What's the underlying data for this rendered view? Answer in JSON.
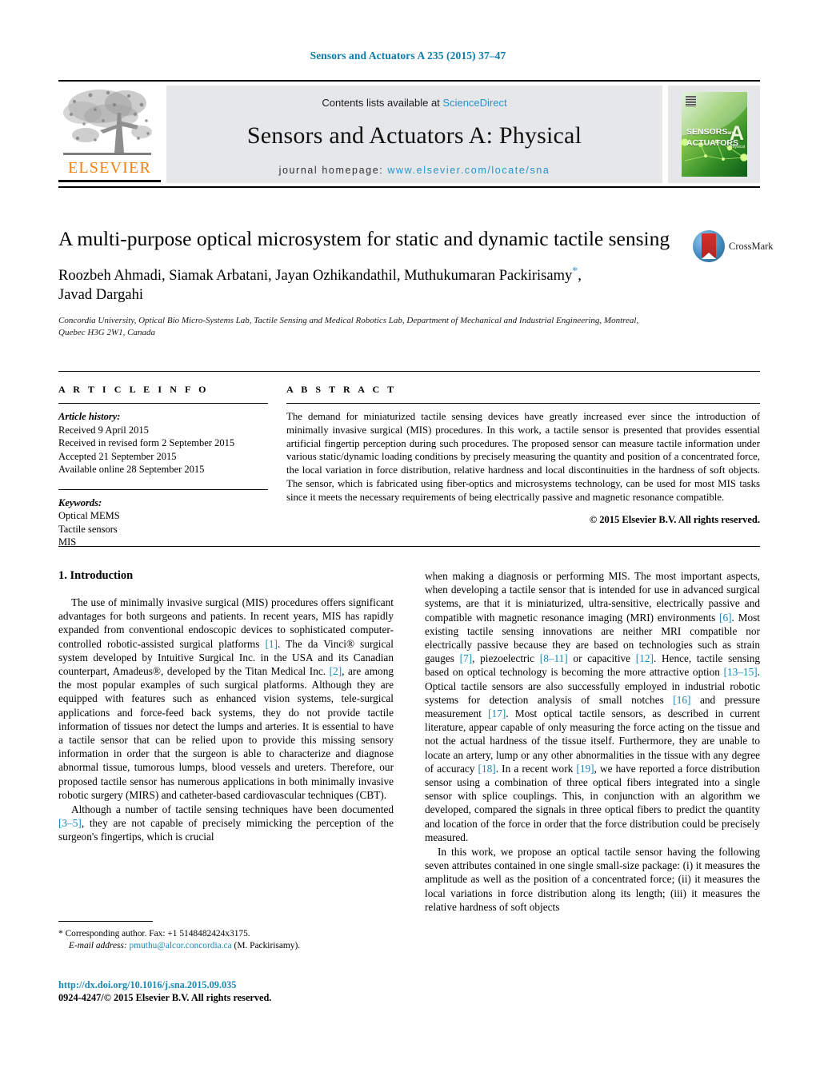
{
  "running_head": "Sensors and Actuators A 235 (2015) 37–47",
  "masthead": {
    "contents_prefix": "Contents lists available at ",
    "contents_link": "ScienceDirect",
    "journal_title": "Sensors and Actuators A: Physical",
    "homepage_prefix": "journal homepage:",
    "homepage_url": "www.elsevier.com/locate/sna",
    "publisher_name": "ELSEVIER",
    "cover": {
      "line1": "SENSORS",
      "line1_small": "and",
      "line2": "ACTUATORS",
      "big_letter": "A",
      "sub_letter": "Physical"
    }
  },
  "article": {
    "title": "A multi-purpose optical microsystem for static and dynamic tactile sensing",
    "authors": "Roozbeh Ahmadi, Siamak Arbatani, Jayan Ozhikandathil, Muthukumaran Packirisamy",
    "authors_line2": "Javad Dargahi",
    "corresponding_marker": "*",
    "affiliation": "Concordia University, Optical Bio Micro-Systems Lab, Tactile Sensing and Medical Robotics Lab, Department of Mechanical and Industrial Engineering, Montreal, Quebec H3G 2W1, Canada",
    "crossmark_label": "CrossMark"
  },
  "article_info": {
    "heading": "A R T I C L E   I N F O",
    "history_label": "Article history:",
    "history": [
      "Received 9 April 2015",
      "Received in revised form 2 September 2015",
      "Accepted 21 September 2015",
      "Available online 28 September 2015"
    ],
    "keywords_label": "Keywords:",
    "keywords": [
      "Optical MEMS",
      "Tactile sensors",
      "MIS"
    ]
  },
  "abstract": {
    "heading": "A B S T R A C T",
    "text": "The demand for miniaturized tactile sensing devices have greatly increased ever since the introduction of minimally invasive surgical (MIS) procedures. In this work, a tactile sensor is presented that provides essential artificial fingertip perception during such procedures. The proposed sensor can measure tactile information under various static/dynamic loading conditions by precisely measuring the quantity and position of a concentrated force, the local variation in force distribution, relative hardness and local discontinuities in the hardness of soft objects. The sensor, which is fabricated using fiber-optics and microsystems technology, can be used for most MIS tasks since it meets the necessary requirements of being electrically passive and magnetic resonance compatible.",
    "copyright": "© 2015 Elsevier B.V. All rights reserved."
  },
  "body": {
    "section_heading": "1. Introduction",
    "left_paragraphs": [
      {
        "parts": [
          {
            "t": "The use of minimally invasive surgical (MIS) procedures offers significant advantages for both surgeons and patients. In recent years, MIS has rapidly expanded from conventional endoscopic devices to sophisticated computer-controlled robotic-assisted surgical platforms "
          },
          {
            "t": "[1]",
            "ref": true
          },
          {
            "t": ". The da Vinci® surgical system developed by Intuitive Surgical Inc. in the USA and its Canadian counterpart, Amadeus®, developed by the Titan Medical Inc. "
          },
          {
            "t": "[2]",
            "ref": true
          },
          {
            "t": ", are among the most popular examples of such surgical platforms. Although they are equipped with features such as enhanced vision systems, tele-surgical applications and force-feed back systems, they do not provide tactile information of tissues nor detect the lumps and arteries. It is essential to have a tactile sensor that can be relied upon to provide this missing sensory information in order that the surgeon is able to characterize and diagnose abnormal tissue, tumorous lumps, blood vessels and ureters. Therefore, our proposed tactile sensor has numerous applications in both minimally invasive robotic surgery (MIRS) and catheter-based cardiovascular techniques (CBT)."
          }
        ]
      },
      {
        "parts": [
          {
            "t": "Although a number of tactile sensing techniques have been documented "
          },
          {
            "t": "[3–5]",
            "ref": true
          },
          {
            "t": ", they are not capable of precisely mimicking the perception of the surgeon's fingertips, which is crucial"
          }
        ]
      }
    ],
    "right_paragraphs": [
      {
        "indent": false,
        "parts": [
          {
            "t": "when making a diagnosis or performing MIS. The most important aspects, when developing a tactile sensor that is intended for use in advanced surgical systems, are that it is miniaturized, ultra-sensitive, electrically passive and compatible with magnetic resonance imaging (MRI) environments "
          },
          {
            "t": "[6]",
            "ref": true
          },
          {
            "t": ". Most existing tactile sensing innovations are neither MRI compatible nor electrically passive because they are based on technologies such as strain gauges "
          },
          {
            "t": "[7]",
            "ref": true
          },
          {
            "t": ", piezoelectric "
          },
          {
            "t": "[8–11]",
            "ref": true
          },
          {
            "t": " or capacitive "
          },
          {
            "t": "[12]",
            "ref": true
          },
          {
            "t": ". Hence, tactile sensing based on optical technology is becoming the more attractive option "
          },
          {
            "t": "[13–15]",
            "ref": true
          },
          {
            "t": ". Optical tactile sensors are also successfully employed in industrial robotic systems for detection analysis of small notches "
          },
          {
            "t": "[16]",
            "ref": true
          },
          {
            "t": " and pressure measurement "
          },
          {
            "t": "[17]",
            "ref": true
          },
          {
            "t": ". Most optical tactile sensors, as described in current literature, appear capable of only measuring the force acting on the tissue and not the actual hardness of the tissue itself. Furthermore, they are unable to locate an artery, lump or any other abnormalities in the tissue with any degree of accuracy "
          },
          {
            "t": "[18]",
            "ref": true
          },
          {
            "t": ". In a recent work "
          },
          {
            "t": "[19]",
            "ref": true
          },
          {
            "t": ", we have reported a force distribution sensor using a combination of three optical fibers integrated into a single sensor with splice couplings. This, in conjunction with an algorithm we developed, compared the signals in three optical fibers to predict the quantity and location of the force in order that the force distribution could be precisely measured."
          }
        ]
      },
      {
        "indent": true,
        "parts": [
          {
            "t": "In this work, we propose an optical tactile sensor having the following seven attributes contained in one single small-size package: (i) it measures the amplitude as well as the position of a concentrated force; (ii) it measures the local variations in force distribution along its length; (iii) it measures the relative hardness of soft objects"
          }
        ]
      }
    ]
  },
  "footer": {
    "corresponding_marker": "*",
    "corresponding_text": "Corresponding author. Fax: +1 5148482424x3175.",
    "email_label": "E-mail address:",
    "email": "pmuthu@alcor.concordia.ca",
    "email_attrib": "(M. Packirisamy).",
    "doi": "http://dx.doi.org/10.1016/j.sna.2015.09.035",
    "issn_line": "0924-4247/© 2015 Elsevier B.V. All rights reserved."
  },
  "colors": {
    "link": "#1b87b5",
    "header_teal": "#0b7cac",
    "elsevier_orange": "#f08010",
    "panel_gray": "#e6e7e9"
  }
}
